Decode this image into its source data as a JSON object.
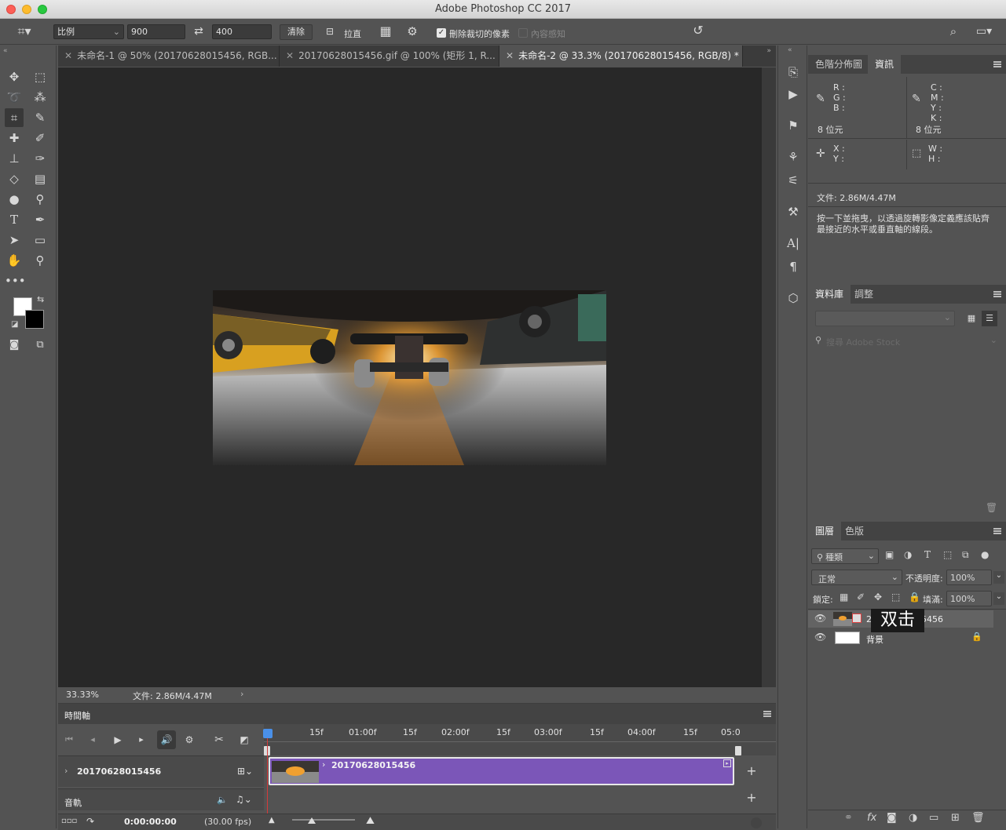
{
  "window": {
    "title": "Adobe Photoshop CC 2017"
  },
  "options": {
    "ratio": "比例",
    "width": "900",
    "height": "400",
    "clear": "清除",
    "straighten": "拉直",
    "delete_cropped": "刪除裁切的像素",
    "content_aware": "內容感知"
  },
  "tabs": [
    {
      "label": "未命名-1 @ 50% (20170628015456, RGB..."
    },
    {
      "label": "20170628015456.gif @ 100% (矩形 1, R..."
    },
    {
      "label": "未命名-2 @ 33.3% (20170628015456, RGB/8) *"
    }
  ],
  "status": {
    "zoom": "33.33%",
    "doc": "文件: 2.86M/4.47M"
  },
  "timeline": {
    "title": "時間軸",
    "ruler": [
      "15f",
      "01:00f",
      "15f",
      "02:00f",
      "15f",
      "03:00f",
      "15f",
      "04:00f",
      "15f",
      "05:0"
    ],
    "track_name": "20170628015456",
    "clip_name": "20170628015456",
    "audio_label": "音軌",
    "timecode": "0:00:00:00",
    "fps": "(30.00 fps)"
  },
  "info_panel": {
    "tabs": [
      "色階分佈圖",
      "資訊"
    ],
    "rgb": [
      "R :",
      "G :",
      "B :"
    ],
    "cmyk": [
      "C :",
      "M :",
      "Y :",
      "K :"
    ],
    "bits_left": "8 位元",
    "bits_right": "8 位元",
    "xy": [
      "X :",
      "Y :"
    ],
    "wh": [
      "W :",
      "H :"
    ],
    "doc": "文件: 2.86M/4.47M",
    "hint": "按一下並拖曳，以透過旋轉影像定義應該貼齊最接近的水平或垂直軸的線段。"
  },
  "library_panel": {
    "tabs": [
      "資料庫",
      "調整"
    ],
    "search_placeholder": "搜尋 Adobe Stock"
  },
  "layers_panel": {
    "tabs": [
      "圖層",
      "色版"
    ],
    "filter": "種類",
    "blend": "正常",
    "opacity_label": "不透明度:",
    "opacity": "100%",
    "lock_label": "鎖定:",
    "fill_label": "填滿:",
    "fill": "100%",
    "layers": [
      {
        "name": "20170628015456"
      },
      {
        "name": "背景"
      }
    ],
    "tooltip": "双击"
  }
}
